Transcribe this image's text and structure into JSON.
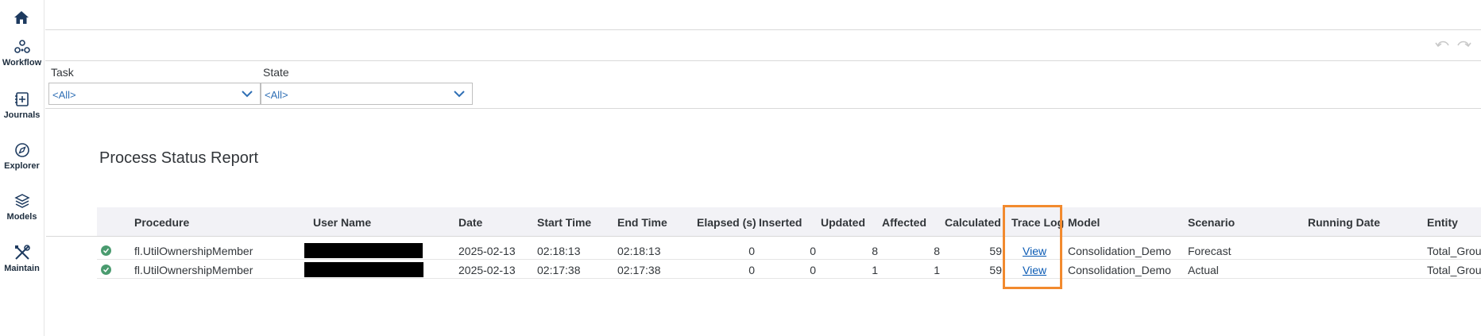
{
  "nav": {
    "items": [
      {
        "label": "Workflow",
        "icon": "workflow-icon"
      },
      {
        "label": "Journals",
        "icon": "journal-icon"
      },
      {
        "label": "Explorer",
        "icon": "compass-icon"
      },
      {
        "label": "Models",
        "icon": "layers-icon"
      },
      {
        "label": "Maintain",
        "icon": "tools-icon"
      }
    ]
  },
  "filters": {
    "task": {
      "label": "Task",
      "value": "<All>"
    },
    "state": {
      "label": "State",
      "value": "<All>"
    }
  },
  "report": {
    "title": "Process Status Report",
    "columns": [
      "Procedure",
      "User Name",
      "Date",
      "Start Time",
      "End Time",
      "Elapsed (s)",
      "Inserted",
      "Updated",
      "Affected",
      "Calculated",
      "Trace Log",
      "Model",
      "Scenario",
      "Running Date",
      "Entity"
    ],
    "rows": [
      {
        "status": "success",
        "procedure": "fl.UtilOwnershipMember",
        "user_name": "",
        "date": "2025-02-13",
        "start_time": "02:18:13",
        "end_time": "02:18:13",
        "elapsed": "0",
        "inserted": "0",
        "updated": "8",
        "affected": "8",
        "calculated": "59",
        "trace_log": "View",
        "model": "Consolidation_Demo",
        "scenario": "Forecast",
        "running_date": "",
        "entity": "Total_Grou"
      },
      {
        "status": "success",
        "procedure": "fl.UtilOwnershipMember",
        "user_name": "",
        "date": "2025-02-13",
        "start_time": "02:17:38",
        "end_time": "02:17:38",
        "elapsed": "0",
        "inserted": "0",
        "updated": "1",
        "affected": "1",
        "calculated": "59",
        "trace_log": "View",
        "model": "Consolidation_Demo",
        "scenario": "Actual",
        "running_date": "",
        "entity": "Total_Grou"
      }
    ]
  },
  "colors": {
    "accent": "#0a5ab4",
    "highlight": "#f28a2e",
    "success": "#4a9b6f",
    "header_bg": "#f2f2f6"
  }
}
